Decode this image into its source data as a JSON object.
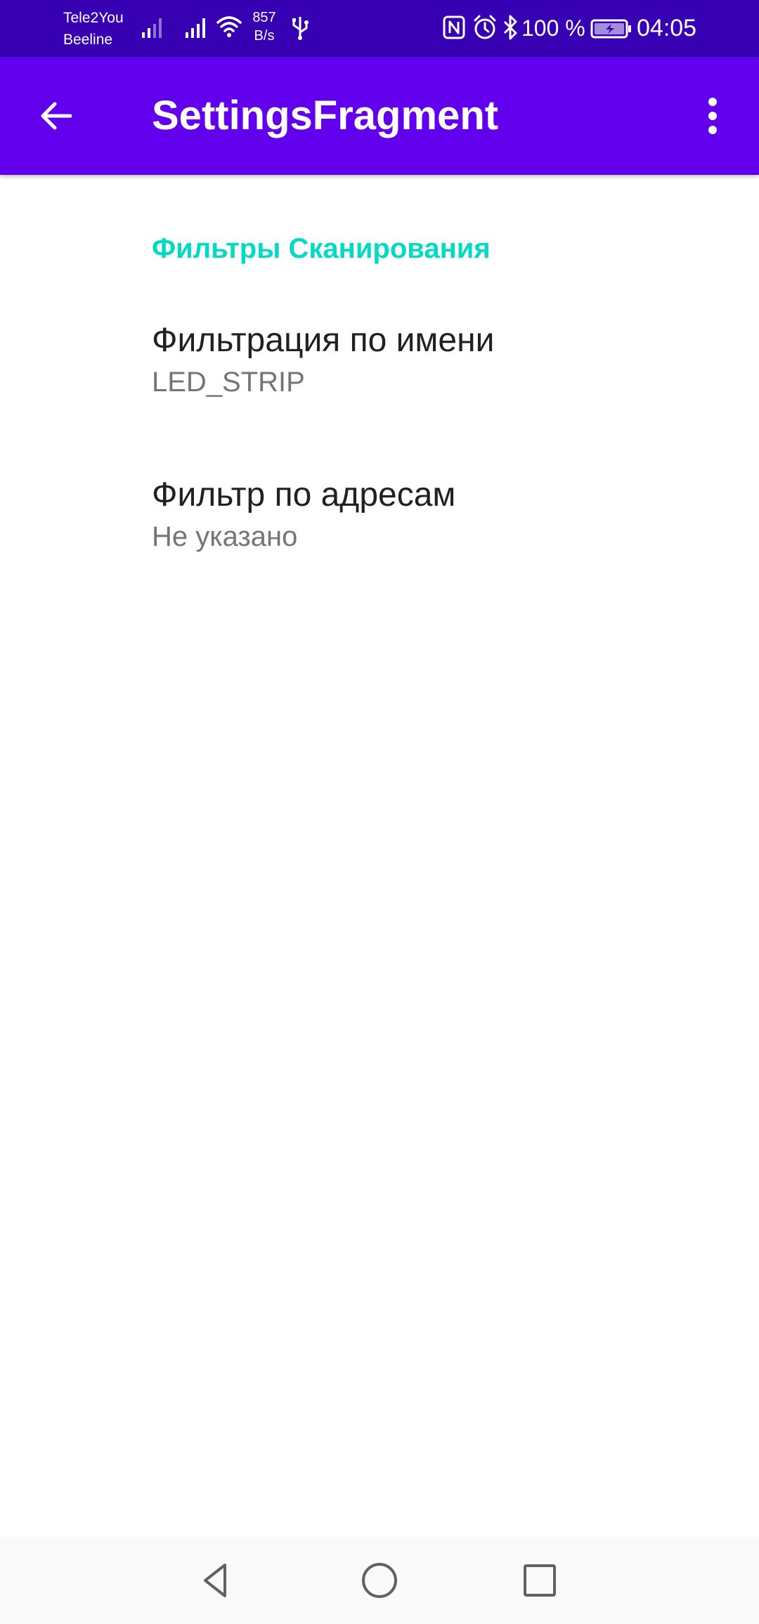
{
  "status_bar": {
    "carrier_1": "Tele2You",
    "carrier_2": "Beeline",
    "net_speed_value": "857",
    "net_speed_unit": "B/s",
    "battery": "100 %",
    "time": "04:05",
    "icons": [
      "signal-icon",
      "signal-icon",
      "wifi-icon",
      "usb-icon",
      "nfc-icon",
      "alarm-icon",
      "bluetooth-icon",
      "battery-icon"
    ]
  },
  "app_bar": {
    "title": "SettingsFragment",
    "background_color": "#6200ee",
    "status_bar_color": "#3700b3",
    "back_icon": "arrow-back-icon",
    "menu_icon": "more-vert-icon"
  },
  "preferences": {
    "category": {
      "title": "Фильтры Сканирования",
      "color": "#03dac5"
    },
    "items": [
      {
        "title": "Фильтрация по имени",
        "summary": "LED_STRIP"
      },
      {
        "title": "Фильтр по адресам",
        "summary": "Не указано"
      }
    ]
  },
  "nav_bar": {
    "icons": [
      "triangle-back-icon",
      "circle-home-icon",
      "square-recents-icon"
    ]
  }
}
